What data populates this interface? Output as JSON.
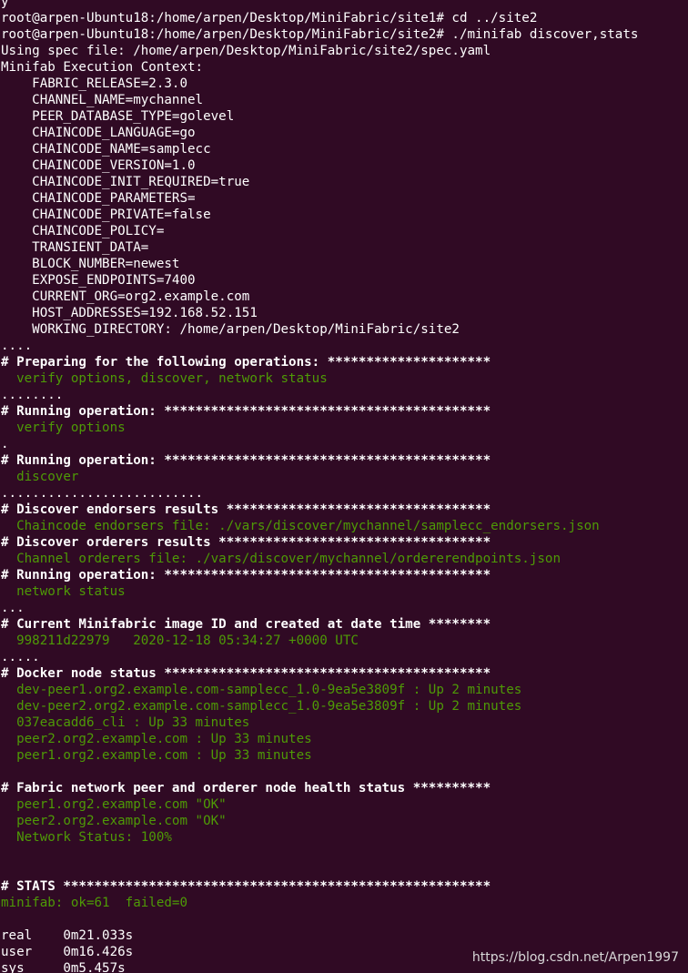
{
  "colors": {
    "background": "#300a24",
    "text": "#ffffff",
    "green": "#4e9a06"
  },
  "terminal": {
    "lines": [
      {
        "text": "y",
        "style": "w"
      },
      {
        "text": "root@arpen-Ubuntu18:/home/arpen/Desktop/MiniFabric/site1# cd ../site2",
        "style": "w"
      },
      {
        "text": "root@arpen-Ubuntu18:/home/arpen/Desktop/MiniFabric/site2# ./minifab discover,stats",
        "style": "w"
      },
      {
        "text": "Using spec file: /home/arpen/Desktop/MiniFabric/site2/spec.yaml",
        "style": "w"
      },
      {
        "text": "Minifab Execution Context:",
        "style": "w"
      },
      {
        "text": "    FABRIC_RELEASE=2.3.0",
        "style": "w"
      },
      {
        "text": "    CHANNEL_NAME=mychannel",
        "style": "w"
      },
      {
        "text": "    PEER_DATABASE_TYPE=golevel",
        "style": "w"
      },
      {
        "text": "    CHAINCODE_LANGUAGE=go",
        "style": "w"
      },
      {
        "text": "    CHAINCODE_NAME=samplecc",
        "style": "w"
      },
      {
        "text": "    CHAINCODE_VERSION=1.0",
        "style": "w"
      },
      {
        "text": "    CHAINCODE_INIT_REQUIRED=true",
        "style": "w"
      },
      {
        "text": "    CHAINCODE_PARAMETERS=",
        "style": "w"
      },
      {
        "text": "    CHAINCODE_PRIVATE=false",
        "style": "w"
      },
      {
        "text": "    CHAINCODE_POLICY=",
        "style": "w"
      },
      {
        "text": "    TRANSIENT_DATA=",
        "style": "w"
      },
      {
        "text": "    BLOCK_NUMBER=newest",
        "style": "w"
      },
      {
        "text": "    EXPOSE_ENDPOINTS=7400",
        "style": "w"
      },
      {
        "text": "    CURRENT_ORG=org2.example.com",
        "style": "w"
      },
      {
        "text": "    HOST_ADDRESSES=192.168.52.151",
        "style": "w"
      },
      {
        "text": "    WORKING_DIRECTORY: /home/arpen/Desktop/MiniFabric/site2",
        "style": "w"
      },
      {
        "text": "....",
        "style": "w"
      },
      {
        "text": "# Preparing for the following operations: *********************",
        "style": "b"
      },
      {
        "text": "  verify options, discover, network status",
        "style": "g"
      },
      {
        "text": "........",
        "style": "w"
      },
      {
        "text": "# Running operation: ******************************************",
        "style": "b"
      },
      {
        "text": "  verify options",
        "style": "g"
      },
      {
        "text": ".",
        "style": "w"
      },
      {
        "text": "# Running operation: ******************************************",
        "style": "b"
      },
      {
        "text": "  discover",
        "style": "g"
      },
      {
        "text": "..........................",
        "style": "w"
      },
      {
        "text": "# Discover endorsers results **********************************",
        "style": "b"
      },
      {
        "text": "  Chaincode endorsers file: ./vars/discover/mychannel/samplecc_endorsers.json",
        "style": "g"
      },
      {
        "text": "# Discover orderers results ***********************************",
        "style": "b"
      },
      {
        "text": "  Channel orderers file: ./vars/discover/mychannel/ordererendpoints.json",
        "style": "g"
      },
      {
        "text": "# Running operation: ******************************************",
        "style": "b"
      },
      {
        "text": "  network status",
        "style": "g"
      },
      {
        "text": "...",
        "style": "w"
      },
      {
        "text": "# Current Minifabric image ID and created at date time ********",
        "style": "b"
      },
      {
        "text": "  998211d22979   2020-12-18 05:34:27 +0000 UTC",
        "style": "g"
      },
      {
        "text": ".....",
        "style": "w"
      },
      {
        "text": "# Docker node status ******************************************",
        "style": "b"
      },
      {
        "text": "  dev-peer1.org2.example.com-samplecc_1.0-9ea5e3809f : Up 2 minutes",
        "style": "g"
      },
      {
        "text": "  dev-peer2.org2.example.com-samplecc_1.0-9ea5e3809f : Up 2 minutes",
        "style": "g"
      },
      {
        "text": "  037eacadd6_cli : Up 33 minutes",
        "style": "g"
      },
      {
        "text": "  peer2.org2.example.com : Up 33 minutes",
        "style": "g"
      },
      {
        "text": "  peer1.org2.example.com : Up 33 minutes",
        "style": "g"
      },
      {
        "text": "",
        "style": "w"
      },
      {
        "text": "# Fabric network peer and orderer node health status **********",
        "style": "b"
      },
      {
        "text": "  peer1.org2.example.com \"OK\"",
        "style": "g"
      },
      {
        "text": "  peer2.org2.example.com \"OK\"",
        "style": "g"
      },
      {
        "text": "  Network Status: 100%",
        "style": "g"
      },
      {
        "text": "",
        "style": "w"
      },
      {
        "text": "",
        "style": "w"
      },
      {
        "text": "# STATS *******************************************************",
        "style": "b"
      },
      {
        "text": "minifab: ok=61  failed=0",
        "style": "g"
      },
      {
        "text": "",
        "style": "w"
      },
      {
        "text": "real\t0m21.033s",
        "style": "w"
      },
      {
        "text": "user\t0m16.426s",
        "style": "w"
      },
      {
        "text": "sys\t0m5.457s",
        "style": "w"
      }
    ]
  },
  "watermark": {
    "text": "https://blog.csdn.net/Arpen1997"
  }
}
